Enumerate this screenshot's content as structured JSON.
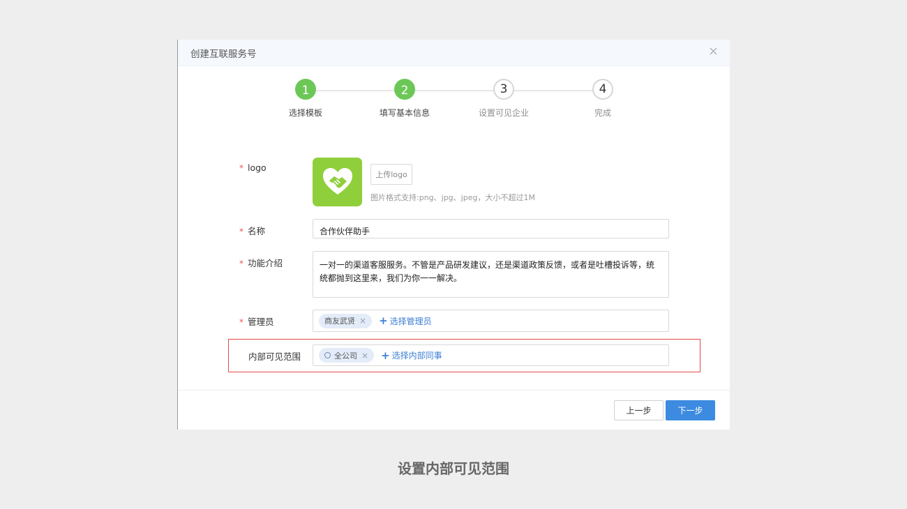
{
  "dialog": {
    "title": "创建互联服务号",
    "close_icon": "×"
  },
  "steps": [
    {
      "number": "1",
      "label": "选择模板",
      "status": "done"
    },
    {
      "number": "2",
      "label": "填写基本信息",
      "status": "done"
    },
    {
      "number": "3",
      "label": "设置可见企业",
      "status": "todo"
    },
    {
      "number": "4",
      "label": "完成",
      "status": "todo"
    }
  ],
  "form": {
    "required_mark": "*",
    "logo": {
      "label": "logo",
      "upload_button": "上传logo",
      "hint": "图片格式支持:png、jpg、jpeg，大小不超过1M"
    },
    "name": {
      "label": "名称",
      "value": "合作伙伴助手"
    },
    "intro": {
      "label": "功能介绍",
      "value": "一对一的渠道客服服务。不管是产品研发建议，还是渠道政策反馈，或者是吐槽投诉等，统统都抛到这里来，我们为你一一解决。"
    },
    "admin": {
      "label": "管理员",
      "tag": "商友武贤",
      "tag_remove": "×",
      "add_plus": "+",
      "add_link": "选择管理员"
    },
    "scope": {
      "label": "内部可见范围",
      "tag": "全公司",
      "tag_remove": "×",
      "add_plus": "+",
      "add_link": "选择内部同事"
    }
  },
  "footer": {
    "prev_button": "上一步",
    "next_button": "下一步"
  },
  "caption": "设置内部可见范围",
  "colors": {
    "step_done": "#6cc757",
    "primary": "#3c8be0",
    "logo_bg": "#8fcf3b",
    "highlight": "#e04a4a",
    "required": "#e55a4e"
  }
}
